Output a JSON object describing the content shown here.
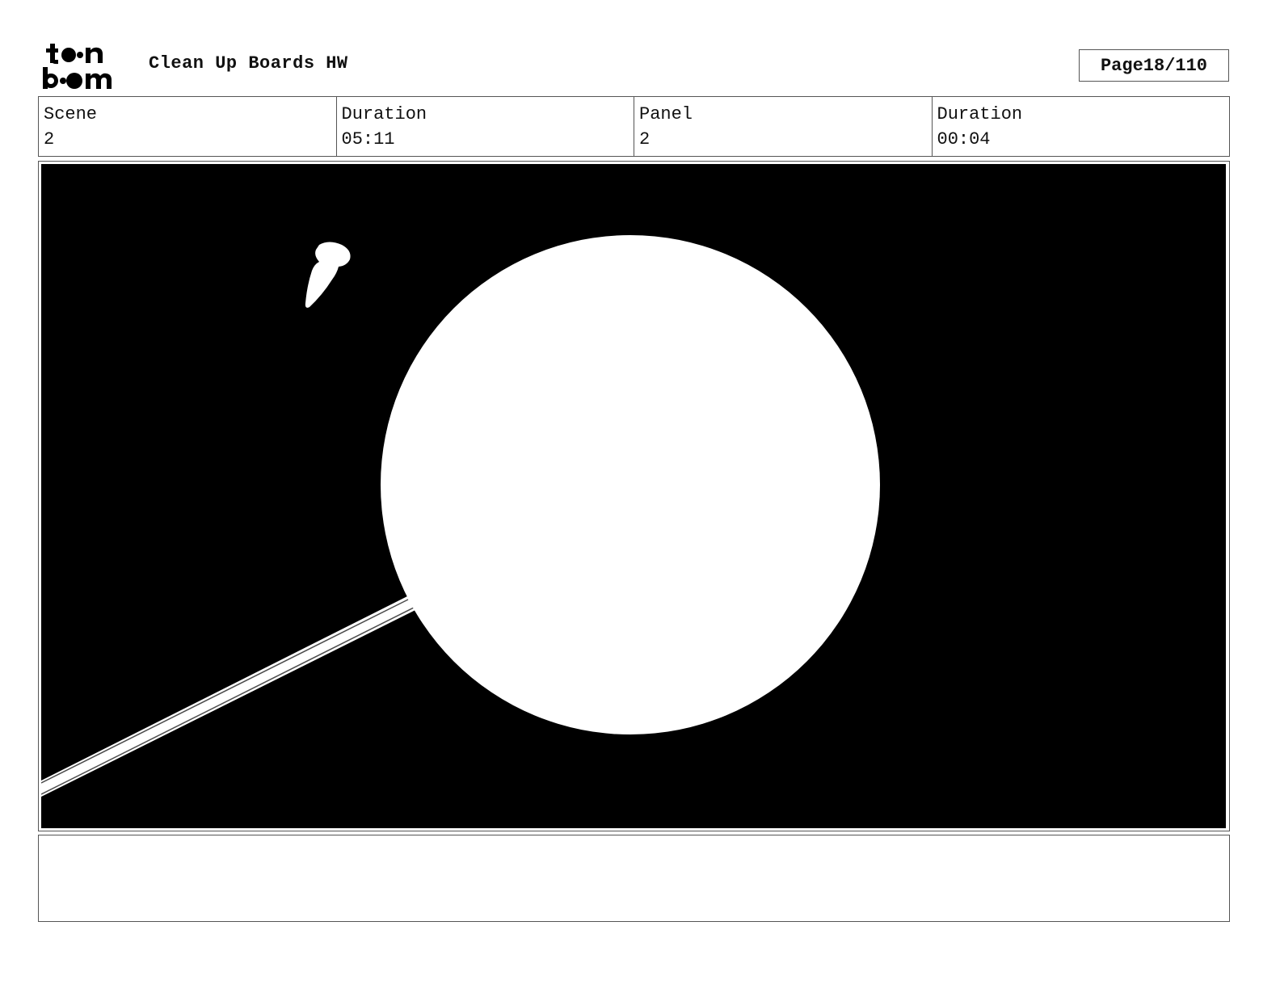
{
  "header": {
    "logo_text": "toon boom",
    "title": "Clean Up Boards HW",
    "page_label": "Page",
    "page_value": "18/110"
  },
  "info": {
    "scene_label": "Scene",
    "scene_value": "2",
    "scene_duration_label": "Duration",
    "scene_duration_value": "05:11",
    "panel_label": "Panel",
    "panel_value": "2",
    "panel_duration_label": "Duration",
    "panel_duration_value": "00:04"
  },
  "notes": {
    "text": ""
  },
  "colors": {
    "panel_background": "#000000",
    "drawing": "#ffffff",
    "border": "#555555"
  }
}
